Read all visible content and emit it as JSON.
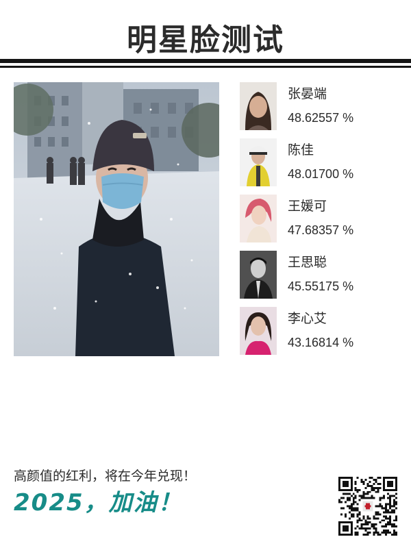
{
  "header": {
    "title": "明星脸测试"
  },
  "photo": {
    "icon": "person-in-snow-photo"
  },
  "matches": [
    {
      "name": "张晏端",
      "score": "48.62557 %",
      "icon": "celebrity-avatar-1"
    },
    {
      "name": "陈佳",
      "score": "48.01700 %",
      "icon": "celebrity-avatar-2"
    },
    {
      "name": "王媛可",
      "score": "47.68357 %",
      "icon": "celebrity-avatar-3"
    },
    {
      "name": "王思聪",
      "score": "45.55175 %",
      "icon": "celebrity-avatar-4"
    },
    {
      "name": "李心艾",
      "score": "43.16814 %",
      "icon": "celebrity-avatar-5"
    }
  ],
  "footer": {
    "tagline": "高颜值的红利，将在今年兑现！",
    "cheer": "2025，加油！",
    "qr_icon": "qr-code-icon"
  },
  "colors": {
    "accent": "#178c88",
    "rule": "#151515",
    "text": "#2a2a2a"
  }
}
